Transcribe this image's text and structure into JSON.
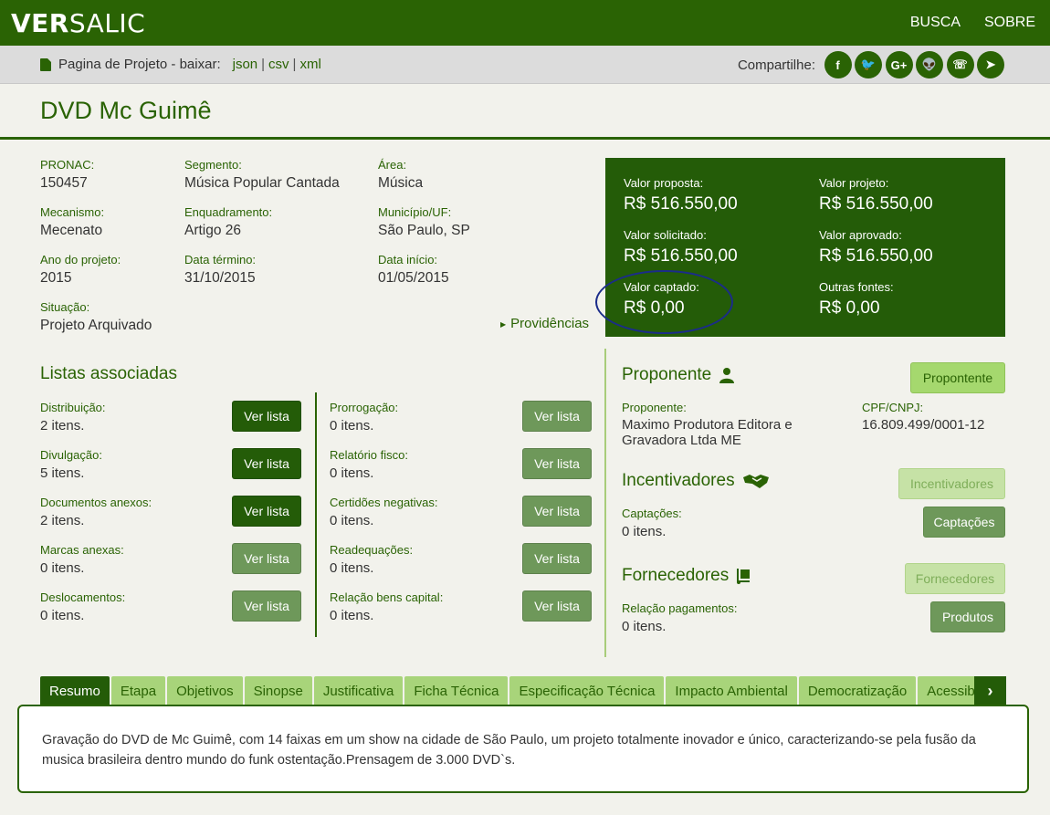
{
  "brand": {
    "bold": "VER",
    "light": "SALIC"
  },
  "nav": [
    {
      "label": "BUSCA"
    },
    {
      "label": "SOBRE"
    }
  ],
  "download": {
    "label": "Pagina de Projeto - baixar:",
    "formats": [
      "json",
      "csv",
      "xml"
    ]
  },
  "share": {
    "label": "Compartilhe:",
    "icons": [
      "facebook-icon",
      "twitter-icon",
      "google-plus-icon",
      "reddit-icon",
      "whatsapp-icon",
      "telegram-icon"
    ],
    "glyphs": [
      "f",
      "🐦",
      "G+",
      "👽",
      "☏",
      "➤"
    ]
  },
  "project": {
    "title": "DVD Mc Guimê",
    "fields": {
      "pronac": {
        "label": "PRONAC:",
        "value": "150457"
      },
      "segmento": {
        "label": "Segmento:",
        "value": "Música Popular Cantada"
      },
      "area": {
        "label": "Área:",
        "value": "Música"
      },
      "mecanismo": {
        "label": "Mecanismo:",
        "value": "Mecenato"
      },
      "enquadramento": {
        "label": "Enquadramento:",
        "value": "Artigo 26"
      },
      "municipio": {
        "label": "Município/UF:",
        "value": "São Paulo, SP"
      },
      "ano": {
        "label": "Ano do projeto:",
        "value": "2015"
      },
      "termino": {
        "label": "Data término:",
        "value": "31/10/2015"
      },
      "inicio": {
        "label": "Data início:",
        "value": "01/05/2015"
      },
      "situacao": {
        "label": "Situação:",
        "value": "Projeto Arquivado"
      }
    },
    "providencias": "Providências"
  },
  "values": {
    "proposta": {
      "label": "Valor proposta:",
      "value": "R$ 516.550,00"
    },
    "projeto": {
      "label": "Valor projeto:",
      "value": "R$ 516.550,00"
    },
    "solicitado": {
      "label": "Valor solicitado:",
      "value": "R$ 516.550,00"
    },
    "aprovado": {
      "label": "Valor aprovado:",
      "value": "R$ 516.550,00"
    },
    "captado": {
      "label": "Valor captado:",
      "value": "R$ 0,00"
    },
    "outras": {
      "label": "Outras fontes:",
      "value": "R$ 0,00"
    }
  },
  "listas": {
    "title": "Listas associadas",
    "button_label": "Ver lista",
    "left": [
      {
        "label": "Distribuição:",
        "count": "2 itens.",
        "active": true
      },
      {
        "label": "Divulgação:",
        "count": "5 itens.",
        "active": true
      },
      {
        "label": "Documentos anexos:",
        "count": "2 itens.",
        "active": true
      },
      {
        "label": "Marcas anexas:",
        "count": "0 itens.",
        "active": false
      },
      {
        "label": "Deslocamentos:",
        "count": "0 itens.",
        "active": false
      }
    ],
    "right": [
      {
        "label": "Prorrogação:",
        "count": "0 itens.",
        "active": false
      },
      {
        "label": "Relatório fisco:",
        "count": "0 itens.",
        "active": false
      },
      {
        "label": "Certidões negativas:",
        "count": "0 itens.",
        "active": false
      },
      {
        "label": "Readequações:",
        "count": "0 itens.",
        "active": false
      },
      {
        "label": "Relação bens capital:",
        "count": "0 itens.",
        "active": false
      }
    ]
  },
  "proponente": {
    "title": "Proponente",
    "button": "Propontente",
    "name_label": "Proponente:",
    "name_line1": "Maximo Produtora Editora e",
    "name_line2": "Gravadora Ltda ME",
    "doc_label": "CPF/CNPJ:",
    "doc_value": "16.809.499/0001-12"
  },
  "incentivadores": {
    "title": "Incentivadores",
    "button": "Incentivadores",
    "cap_label": "Captações:",
    "cap_value": "0 itens.",
    "cap_button": "Captações"
  },
  "fornecedores": {
    "title": "Fornecedores",
    "button": "Fornecedores",
    "rel_label": "Relação pagamentos:",
    "rel_value": "0 itens.",
    "rel_button": "Produtos"
  },
  "tabs": [
    "Resumo",
    "Etapa",
    "Objetivos",
    "Sinopse",
    "Justificativa",
    "Ficha Técnica",
    "Especificação Técnica",
    "Impacto Ambiental",
    "Democratização",
    "Acessibilidade"
  ],
  "tab_arrow": "›",
  "resumo": "Gravação do DVD de Mc Guimê, com 14 faixas em um show na cidade de São Paulo, um projeto totalmente inovador e único, caracterizando-se pela fusão da musica brasileira dentro mundo do funk ostentação.Prensagem de 3.000 DVD`s."
}
